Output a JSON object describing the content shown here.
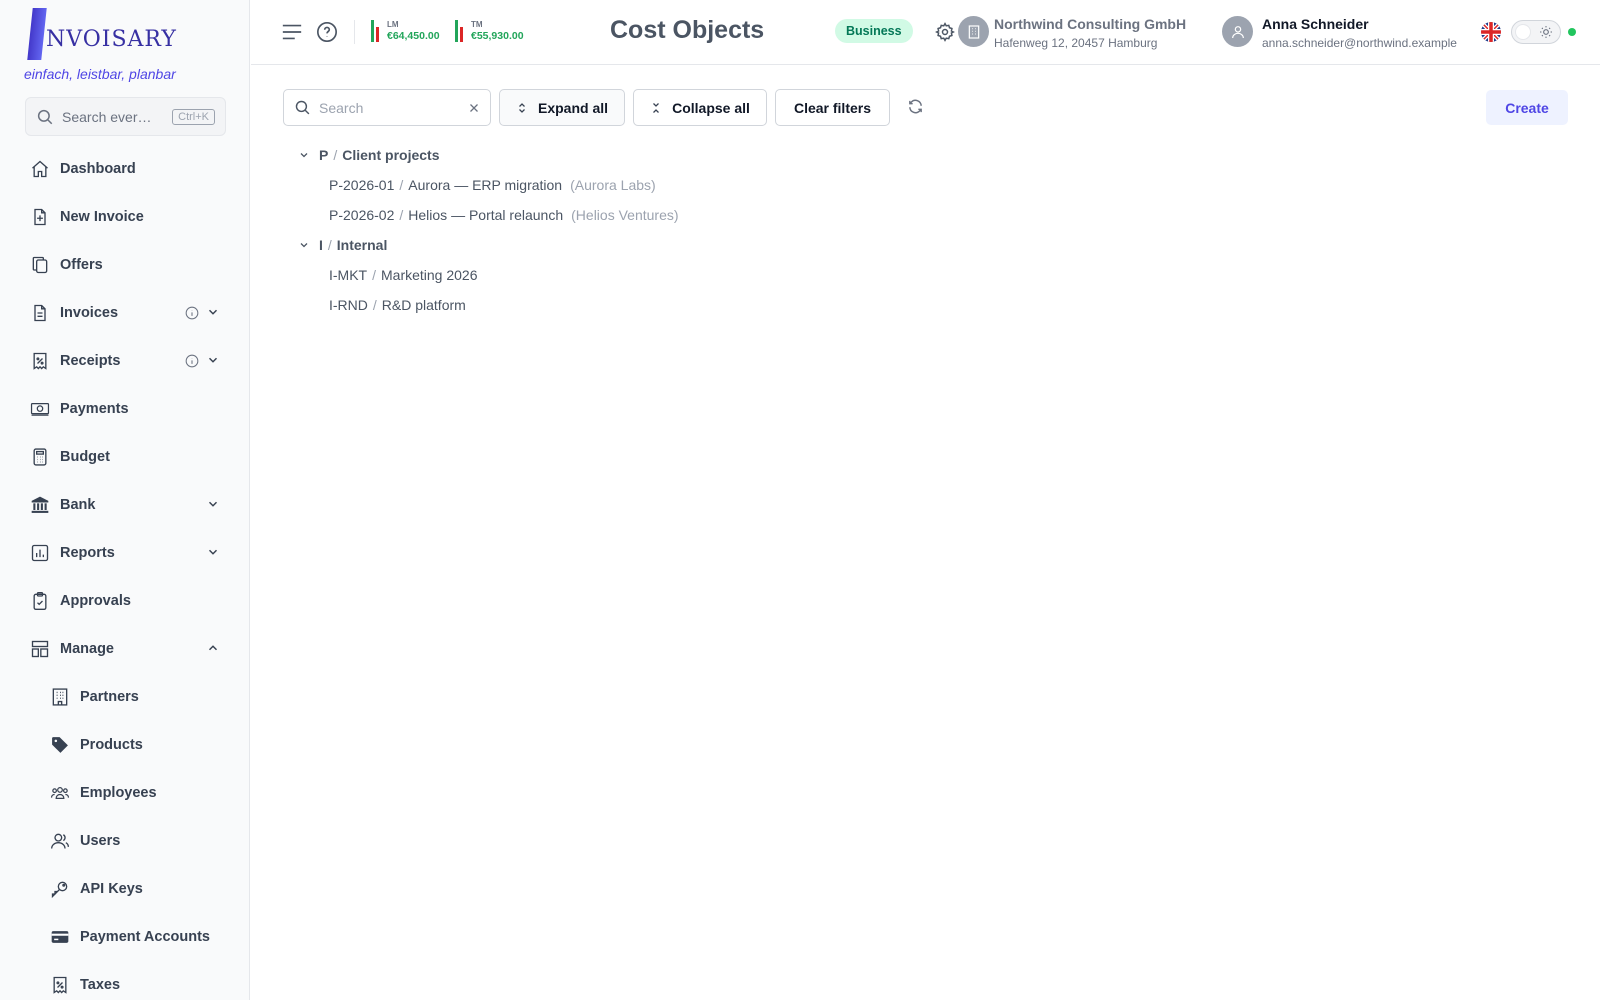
{
  "brand": {
    "logo_text": "NVOISARY",
    "tagline": "einfach, leistbar, planbar"
  },
  "sidebar": {
    "search_placeholder": "Search ever…",
    "search_shortcut": "Ctrl+K",
    "items": [
      {
        "label": "Dashboard",
        "icon": "home-icon"
      },
      {
        "label": "New Invoice",
        "icon": "file-plus-icon"
      },
      {
        "label": "Offers",
        "icon": "copy-icon"
      },
      {
        "label": "Invoices",
        "icon": "document-icon",
        "info": true,
        "expandable": "down"
      },
      {
        "label": "Receipts",
        "icon": "receipt-percent-icon",
        "info": true,
        "expandable": "down"
      },
      {
        "label": "Payments",
        "icon": "banknote-icon"
      },
      {
        "label": "Budget",
        "icon": "calculator-icon"
      },
      {
        "label": "Bank",
        "icon": "bank-icon",
        "expandable": "down"
      },
      {
        "label": "Reports",
        "icon": "bar-chart-icon",
        "expandable": "down"
      },
      {
        "label": "Approvals",
        "icon": "clipboard-check-icon"
      },
      {
        "label": "Manage",
        "icon": "layout-icon",
        "expandable": "up"
      }
    ],
    "manage_items": [
      {
        "label": "Partners",
        "icon": "building-icon"
      },
      {
        "label": "Products",
        "icon": "tag-icon"
      },
      {
        "label": "Employees",
        "icon": "users-group-icon"
      },
      {
        "label": "Users",
        "icon": "users-icon"
      },
      {
        "label": "API Keys",
        "icon": "key-icon"
      },
      {
        "label": "Payment Accounts",
        "icon": "credit-card-icon"
      },
      {
        "label": "Taxes",
        "icon": "tax-receipt-icon"
      }
    ]
  },
  "header": {
    "stats": [
      {
        "label": "LM",
        "value": "€64,450.00"
      },
      {
        "label": "TM",
        "value": "€55,930.00"
      }
    ],
    "title": "Cost Objects",
    "plan_badge": "Business",
    "company": {
      "name": "Northwind Consulting GmbH",
      "address": "Hafenweg 12, 20457 Hamburg"
    },
    "user": {
      "name": "Anna Schneider",
      "email": "anna.schneider@northwind.example"
    }
  },
  "toolbar": {
    "search_placeholder": "Search",
    "expand_all": "Expand all",
    "collapse_all": "Collapse all",
    "clear_filters": "Clear filters",
    "create": "Create"
  },
  "tree": [
    {
      "code": "P",
      "name": "Client projects",
      "children": [
        {
          "code": "P-2026-01",
          "name": "Aurora — ERP migration",
          "partner": "(Aurora Labs)"
        },
        {
          "code": "P-2026-02",
          "name": "Helios — Portal relaunch",
          "partner": "(Helios Ventures)"
        }
      ]
    },
    {
      "code": "I",
      "name": "Internal",
      "children": [
        {
          "code": "I-MKT",
          "name": "Marketing 2026"
        },
        {
          "code": "I-RND",
          "name": "R&D platform"
        }
      ]
    }
  ],
  "separator": "/"
}
